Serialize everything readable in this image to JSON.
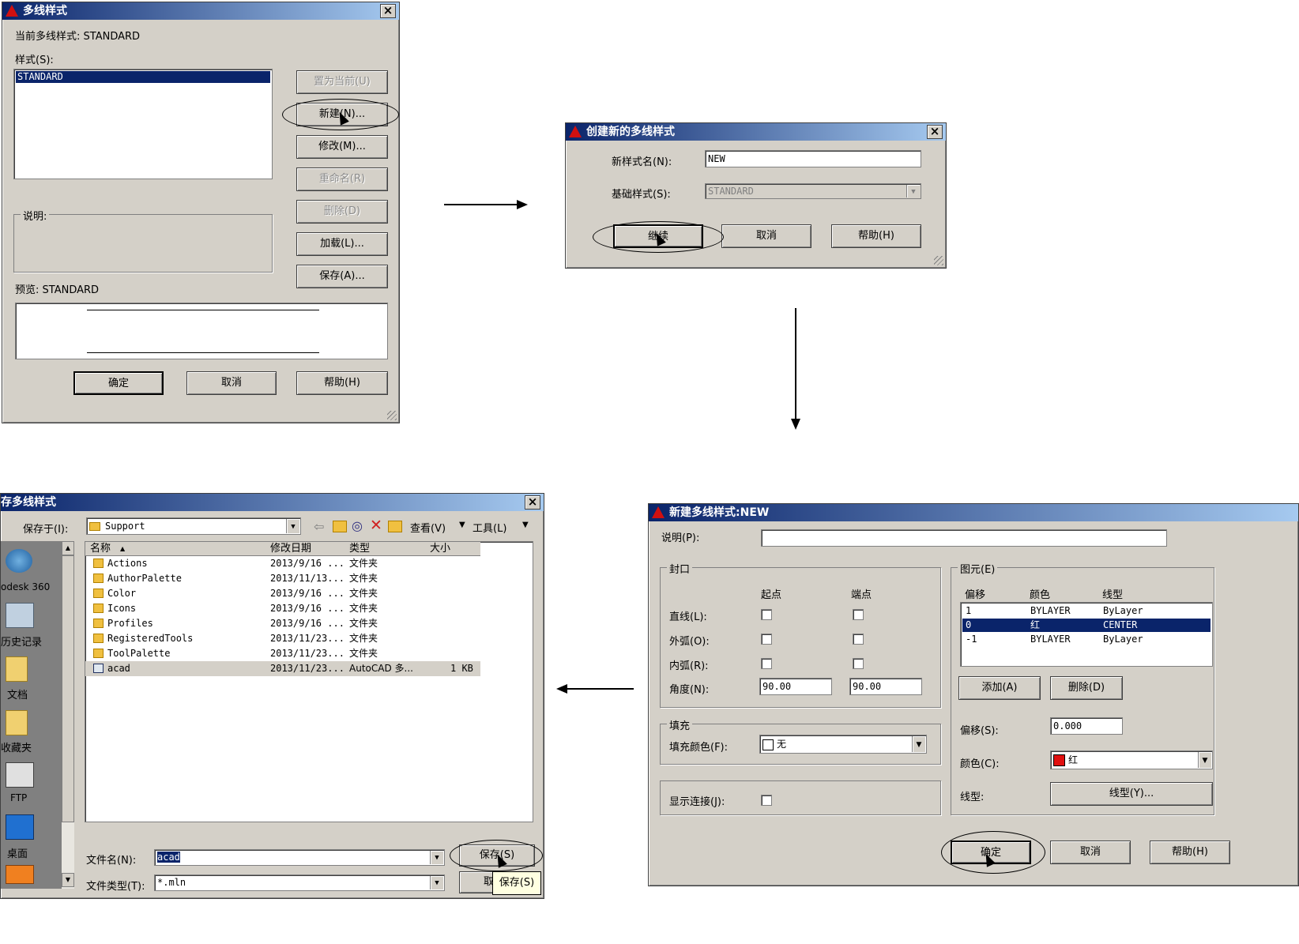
{
  "dialog_mlstyle": {
    "title": "多线样式",
    "current_style": "当前多线样式: STANDARD",
    "styles_label": "样式(S):",
    "style_items": [
      "STANDARD"
    ],
    "btn_set_current": "置为当前(U)",
    "btn_new": "新建(N)...",
    "btn_modify": "修改(M)...",
    "btn_rename": "重命名(R)",
    "btn_delete": "删除(D)",
    "btn_load": "加载(L)...",
    "btn_save": "保存(A)...",
    "desc_label": "说明:",
    "preview_label": "预览: STANDARD",
    "btn_ok": "确定",
    "btn_cancel": "取消",
    "btn_help": "帮助(H)"
  },
  "dialog_create": {
    "title": "创建新的多线样式",
    "name_label": "新样式名(N):",
    "name_value": "NEW",
    "base_label": "基础样式(S):",
    "base_value": "STANDARD",
    "btn_continue": "继续",
    "btn_cancel": "取消",
    "btn_help": "帮助(H)"
  },
  "dialog_new": {
    "title": "新建多线样式:NEW",
    "desc_label": "说明(P):",
    "caps_group": "封口",
    "col_start": "起点",
    "col_end": "端点",
    "line_label": "直线(L):",
    "outer_arc_label": "外弧(O):",
    "inner_arc_label": "内弧(R):",
    "angle_label": "角度(N):",
    "angle_start": "90.00",
    "angle_end": "90.00",
    "fill_group": "填充",
    "fill_color_label": "填充颜色(F):",
    "fill_color_value": "无",
    "show_joints_label": "显示连接(J):",
    "elements_group": "图元(E)",
    "col_offset": "偏移",
    "col_color": "颜色",
    "col_linetype": "线型",
    "elements": [
      {
        "offset": "1",
        "color": "BYLAYER",
        "linetype": "ByLayer"
      },
      {
        "offset": "0",
        "color": "红",
        "linetype": "CENTER"
      },
      {
        "offset": "-1",
        "color": "BYLAYER",
        "linetype": "ByLayer"
      }
    ],
    "btn_add": "添加(A)",
    "btn_delete": "删除(D)",
    "offset_label": "偏移(S):",
    "offset_value": "0.000",
    "color_label": "颜色(C):",
    "color_value": "红",
    "color_swatch": "#e01010",
    "linetype_label": "线型:",
    "btn_linetype": "线型(Y)...",
    "btn_ok": "确定",
    "btn_cancel": "取消",
    "btn_help": "帮助(H)"
  },
  "dialog_save": {
    "title": "存多线样式",
    "save_in_label": "保存于(I):",
    "save_in_value": "Support",
    "view_label": "查看(V)",
    "tools_label": "工具(L)",
    "col_name": "名称",
    "col_date": "修改日期",
    "col_type": "类型",
    "col_size": "大小",
    "files": [
      {
        "name": "Actions",
        "date": "2013/9/16 ...",
        "type": "文件夹",
        "size": ""
      },
      {
        "name": "AuthorPalette",
        "date": "2013/11/13...",
        "type": "文件夹",
        "size": ""
      },
      {
        "name": "Color",
        "date": "2013/9/16 ...",
        "type": "文件夹",
        "size": ""
      },
      {
        "name": "Icons",
        "date": "2013/9/16 ...",
        "type": "文件夹",
        "size": ""
      },
      {
        "name": "Profiles",
        "date": "2013/9/16 ...",
        "type": "文件夹",
        "size": ""
      },
      {
        "name": "RegisteredTools",
        "date": "2013/11/23...",
        "type": "文件夹",
        "size": ""
      },
      {
        "name": "ToolPalette",
        "date": "2013/11/23...",
        "type": "文件夹",
        "size": ""
      },
      {
        "name": "acad",
        "date": "2013/11/23...",
        "type": "AutoCAD 多...",
        "size": "1 KB"
      }
    ],
    "sidebar": [
      "odesk 360",
      "历史记录",
      "文档",
      "收藏夹",
      "FTP",
      "桌面"
    ],
    "filename_label": "文件名(N):",
    "filename_value": "acad",
    "filetype_label": "文件类型(T):",
    "filetype_value": "*.mln",
    "btn_save": "保存(S)",
    "btn_cancel_partial": "取",
    "tooltip": "保存(S)"
  }
}
